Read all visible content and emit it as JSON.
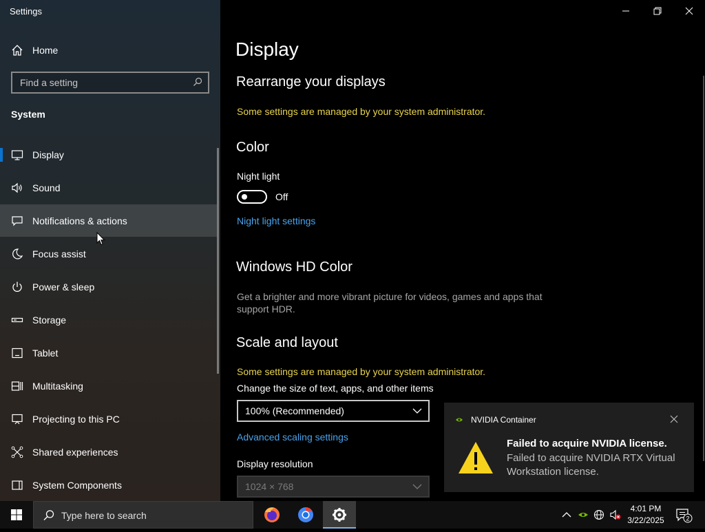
{
  "window": {
    "title": "Settings"
  },
  "sidebar": {
    "home_label": "Home",
    "search_placeholder": "Find a setting",
    "section": "System",
    "items": [
      {
        "label": "Display",
        "icon": "monitor-icon"
      },
      {
        "label": "Sound",
        "icon": "speaker-icon"
      },
      {
        "label": "Notifications & actions",
        "icon": "message-icon"
      },
      {
        "label": "Focus assist",
        "icon": "moon-icon"
      },
      {
        "label": "Power & sleep",
        "icon": "power-icon"
      },
      {
        "label": "Storage",
        "icon": "storage-icon"
      },
      {
        "label": "Tablet",
        "icon": "tablet-icon"
      },
      {
        "label": "Multitasking",
        "icon": "multitasking-icon"
      },
      {
        "label": "Projecting to this PC",
        "icon": "projector-icon"
      },
      {
        "label": "Shared experiences",
        "icon": "shared-icon"
      },
      {
        "label": "System Components",
        "icon": "components-icon"
      }
    ]
  },
  "main": {
    "title": "Display",
    "rearrange": {
      "heading": "Rearrange your displays",
      "admin_note": "Some settings are managed by your system administrator."
    },
    "color": {
      "heading": "Color",
      "night_light_label": "Night light",
      "night_light_state": "Off",
      "night_light_link": "Night light settings"
    },
    "hd_color": {
      "heading": "Windows HD Color",
      "description": "Get a brighter and more vibrant picture for videos, games and apps that support HDR."
    },
    "scale": {
      "heading": "Scale and layout",
      "admin_note": "Some settings are managed by your system administrator.",
      "size_label": "Change the size of text, apps, and other items",
      "size_value": "100% (Recommended)",
      "advanced_link": "Advanced scaling settings",
      "resolution_label": "Display resolution",
      "resolution_value": "1024 × 768"
    }
  },
  "toast": {
    "app_name": "NVIDIA Container",
    "title": "Failed to acquire NVIDIA license.",
    "body": "Failed to acquire NVIDIA RTX Virtual Workstation license."
  },
  "taskbar": {
    "search_placeholder": "Type here to search",
    "time": "4:01 PM",
    "date": "3/22/2025",
    "notification_count": "2"
  },
  "colors": {
    "accent": "#0a74d0",
    "admin_note": "#e8d44d",
    "link": "#4aa3ec",
    "warning": "#f7d21c"
  }
}
